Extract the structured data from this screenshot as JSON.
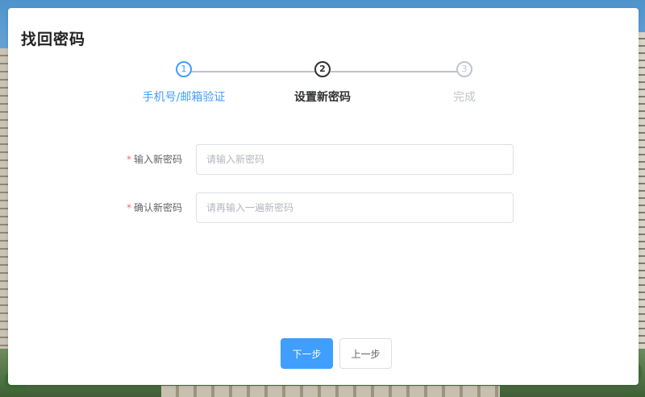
{
  "page": {
    "title": "找回密码"
  },
  "steps": [
    {
      "number": "1",
      "label": "手机号/邮箱验证",
      "state": "finished"
    },
    {
      "number": "2",
      "label": "设置新密码",
      "state": "active"
    },
    {
      "number": "3",
      "label": "完成",
      "state": "pending"
    }
  ],
  "form": {
    "required_mark": "*",
    "new_password": {
      "label": "输入新密码",
      "value": "",
      "placeholder": "请输入新密码"
    },
    "confirm_password": {
      "label": "确认新密码",
      "value": "",
      "placeholder": "请再输入一遍新密码"
    }
  },
  "actions": {
    "next_label": "下一步",
    "prev_label": "上一步"
  },
  "colors": {
    "accent": "#409eff",
    "required": "#f56c6c",
    "active_text": "#303133",
    "pending": "#c0c4cc"
  }
}
